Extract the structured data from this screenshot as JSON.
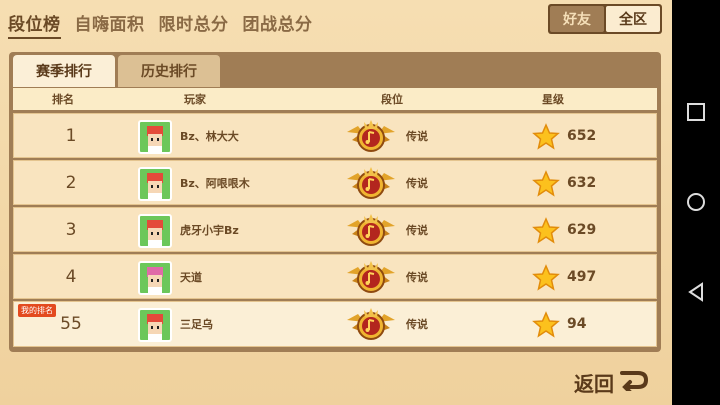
{
  "top_tabs": [
    "段位榜",
    "自嗨面积",
    "限时总分",
    "团战总分"
  ],
  "scope": {
    "friends": "好友",
    "all": "全区"
  },
  "sub_tabs": {
    "season": "赛季排行",
    "history": "历史排行"
  },
  "columns": {
    "rank": "排名",
    "player": "玩家",
    "tier": "段位",
    "stars": "星级"
  },
  "rows": [
    {
      "rank": "1",
      "name": "Bz、林大大",
      "tier": "传说",
      "stars": "652"
    },
    {
      "rank": "2",
      "name": "Bz、阿哏哏木",
      "tier": "传说",
      "stars": "632"
    },
    {
      "rank": "3",
      "name": "虎牙小宇Bz",
      "tier": "传说",
      "stars": "629"
    },
    {
      "rank": "4",
      "name": "天道",
      "tier": "传说",
      "stars": "497"
    }
  ],
  "my_row": {
    "tag": "我的排名",
    "rank": "55",
    "name": "三足乌",
    "tier": "传说",
    "stars": "94"
  },
  "back_label": "返回",
  "colors": {
    "accent": "#6b4a26",
    "panel": "#a07d55",
    "tag": "#e34a1f",
    "avatar_bg": "#6cc75a"
  },
  "icons": {
    "tier": "legend-tier-badge-icon",
    "star": "star-icon",
    "back": "back-arrow-icon"
  }
}
